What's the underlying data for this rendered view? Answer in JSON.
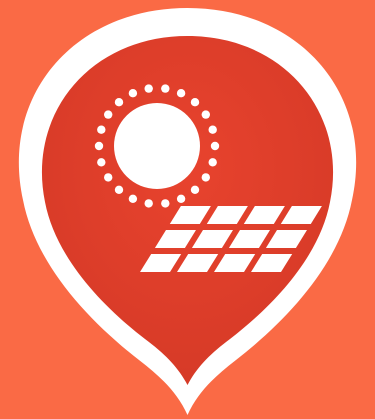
{
  "icon": {
    "name": "solar-energy-location-pin-icon",
    "colors": {
      "background": "#FA6A45",
      "pin_outer": "#FFFFFF",
      "pin_inner": "#E8432E",
      "pin_inner_dark": "#D63A27",
      "symbol": "#FFFFFF"
    }
  }
}
